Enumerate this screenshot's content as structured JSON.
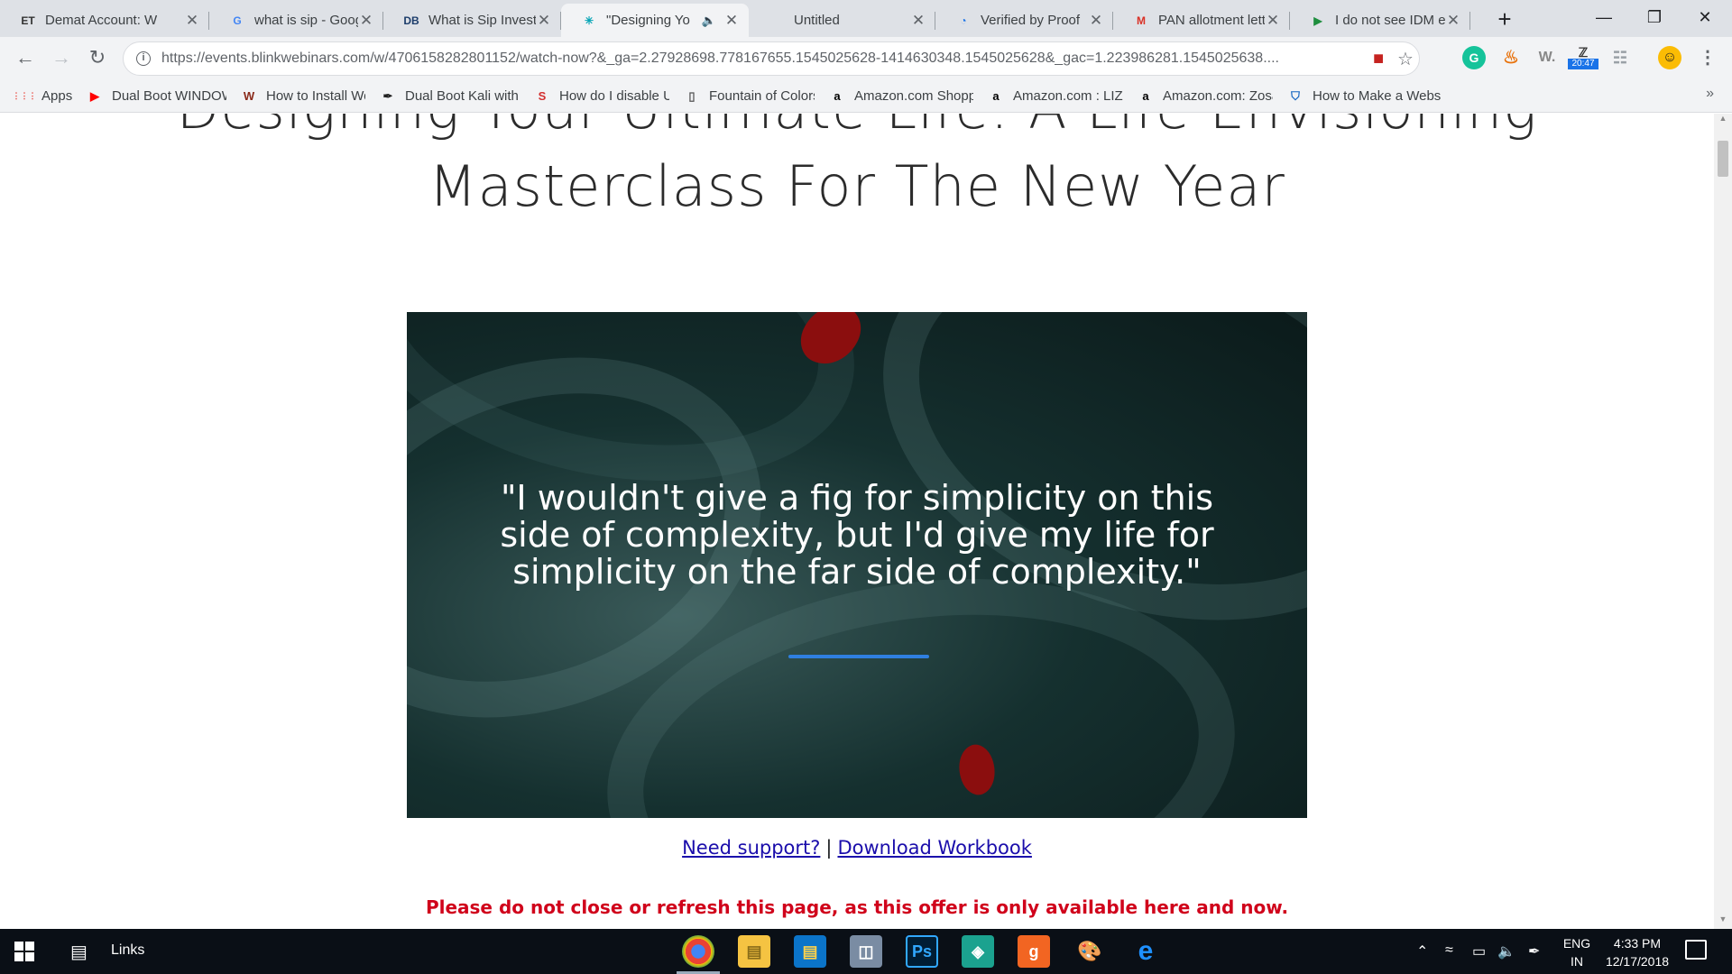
{
  "tabs": [
    {
      "title": "Demat Account: W",
      "icon": "et-icon",
      "fav": "ET",
      "favColor": "#333"
    },
    {
      "title": "what is sip - Googl",
      "icon": "google-icon",
      "fav": "G",
      "favColor": "#4285f4"
    },
    {
      "title": "What is Sip Investr",
      "icon": "db-icon",
      "fav": "DB",
      "favColor": "#1c3d6b"
    },
    {
      "title": "\"Designing Yo",
      "icon": "blink-icon",
      "fav": "✳",
      "favColor": "#00a3b4",
      "active": true
    },
    {
      "title": "Untitled",
      "icon": "blank-icon",
      "fav": "",
      "favColor": "#fff"
    },
    {
      "title": "Verified by Proof",
      "icon": "proof-icon",
      "fav": "◔",
      "favColor": "#1a73e8"
    },
    {
      "title": "PAN allotment lett",
      "icon": "gmail-icon",
      "fav": "M",
      "favColor": "#d93025"
    },
    {
      "title": "I do not see IDM e",
      "icon": "play-icon",
      "fav": "▶",
      "favColor": "#1e8e3e"
    }
  ],
  "toolbar": {
    "url": "https://events.blinkwebinars.com/w/4706158282801152/watch-now?&_ga=2.27928698.778167655.1545025628-1414630348.1545025628&_gac=1.223986281.1545025638....",
    "badge_time": "20:47"
  },
  "bookmarks": [
    {
      "label": "Apps",
      "icon": "apps-grid-icon",
      "glyph": "⋮⋮⋮",
      "color": "#e8453c"
    },
    {
      "label": "Dual Boot WINDOWS",
      "icon": "youtube-icon",
      "glyph": "▶",
      "color": "#ff0000"
    },
    {
      "label": "How to Install WordP",
      "icon": "wpmu-icon",
      "glyph": "W",
      "color": "#8a2a1a"
    },
    {
      "label": "Dual Boot Kali with W",
      "icon": "kali-icon",
      "glyph": "✒",
      "color": "#222"
    },
    {
      "label": "How do I disable UEF",
      "icon": "superuser-icon",
      "glyph": "S",
      "color": "#d32f2f"
    },
    {
      "label": "Fountain of Colors, d",
      "icon": "page-icon",
      "glyph": "▯",
      "color": "#555"
    },
    {
      "label": "Amazon.com Shoppi",
      "icon": "amazon-icon",
      "glyph": "a",
      "color": "#000"
    },
    {
      "label": "Amazon.com : LIZVIE",
      "icon": "amazon-icon",
      "glyph": "a",
      "color": "#000"
    },
    {
      "label": "Amazon.com: Zosam",
      "icon": "amazon-icon",
      "glyph": "a",
      "color": "#000"
    },
    {
      "label": "How to Make a Webs",
      "icon": "shield-icon",
      "glyph": "⛉",
      "color": "#1565c0"
    }
  ],
  "page": {
    "title_line1": "Designing Your Ultimate Life: A Life Envisioning",
    "title_line2": "Masterclass For The New Year",
    "quote": "\"I wouldn't give a fig for simplicity on this side of complexity, but I'd give my life for simplicity on the far side of complexity.\"",
    "support_link": "Need support?",
    "separator": "|",
    "workbook_link": "Download Workbook",
    "warning": "Please do not close or refresh this page, as this offer is only available here and now."
  },
  "taskbar": {
    "links_label": "Links",
    "lang_line1": "ENG",
    "lang_line2": "IN",
    "time": "4:33 PM",
    "date": "12/17/2018"
  }
}
